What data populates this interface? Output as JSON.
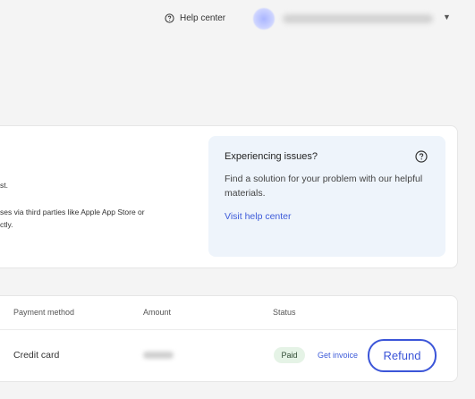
{
  "header": {
    "help_center_label": "Help center",
    "help_icon": "question-circle-icon",
    "menu_icon": "chevron-down-icon"
  },
  "info_card": {
    "fragment_1": "st.",
    "fragment_2": "ses via third parties like Apple App Store or",
    "fragment_3": "ctly."
  },
  "issues_panel": {
    "title": "Experiencing issues?",
    "body": "Find a solution for your problem with our helpful materials.",
    "link_label": "Visit help center",
    "icon": "question-circle-icon"
  },
  "payments_table": {
    "columns": [
      "Payment method",
      "Amount",
      "Status"
    ],
    "rows": [
      {
        "payment_method": "Credit card",
        "status": "Paid",
        "invoice_label": "Get invoice",
        "refund_label": "Refund"
      }
    ]
  },
  "colors": {
    "accent": "#3b55d8",
    "paid_badge_bg": "#e5f3e6",
    "issues_panel_bg": "#eef4fb",
    "page_bg": "#f4f4f4"
  }
}
